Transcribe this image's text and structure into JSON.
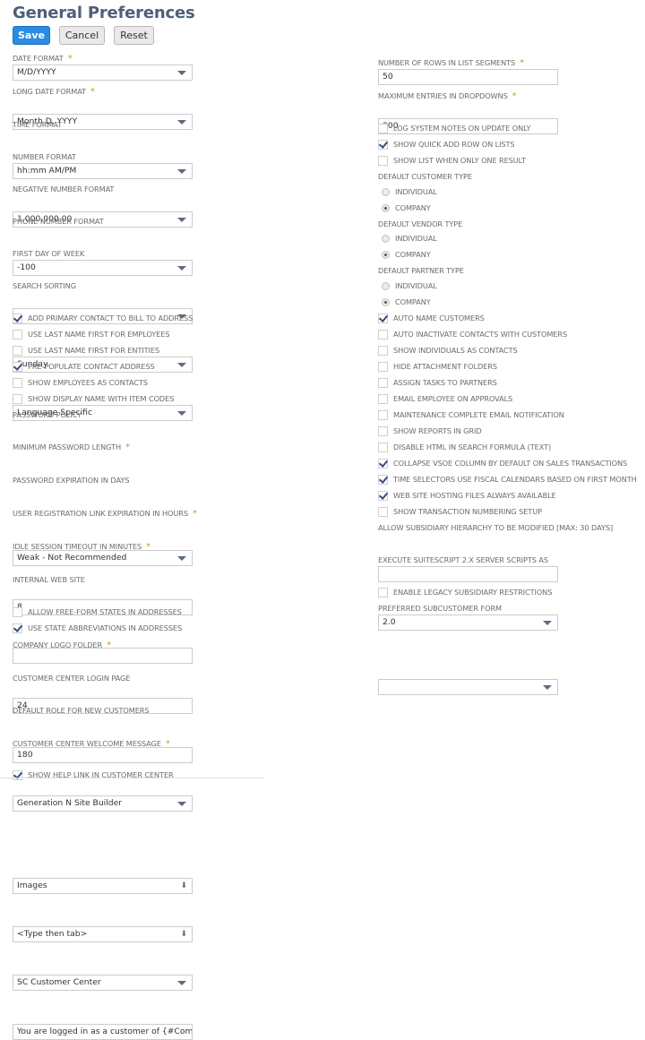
{
  "page": {
    "title": "General Preferences"
  },
  "toolbar": {
    "save": "Save",
    "cancel": "Cancel",
    "reset": "Reset"
  },
  "icons": {
    "dropdown": "caret-down-icon",
    "popup": "double-chevron-down-icon",
    "checkbox_checked": "checkmark-icon",
    "required": "asterisk"
  },
  "colors": {
    "primary_button": "#2b8be2",
    "title": "#4d5f79",
    "required_star": "#c89a2a",
    "checkmark": "#2e4f7e"
  },
  "left": {
    "date_format": {
      "label": "DATE FORMAT",
      "required": "*",
      "value": "M/D/YYYY"
    },
    "long_date_format": {
      "label": "LONG DATE FORMAT",
      "required": "*",
      "value": "Month D, YYYY"
    },
    "time_format": {
      "label": "TIME FORMAT",
      "value": "hh:mm AM/PM"
    },
    "number_format": {
      "label": "NUMBER FORMAT",
      "value": "1,000,000.00"
    },
    "negative_number_format": {
      "label": "NEGATIVE NUMBER FORMAT",
      "value": "-100"
    },
    "phone_number_format": {
      "label": "PHONE NUMBER FORMAT",
      "value": ""
    },
    "first_day_of_week": {
      "label": "FIRST DAY OF WEEK",
      "value": "Sunday"
    },
    "search_sorting": {
      "label": "SEARCH SORTING",
      "value": "Language Specific"
    },
    "checks1": [
      {
        "label": "ADD PRIMARY CONTACT TO BILL TO ADDRESS",
        "checked": true
      },
      {
        "label": "USE LAST NAME FIRST FOR EMPLOYEES",
        "checked": false
      },
      {
        "label": "USE LAST NAME FIRST FOR ENTITIES",
        "checked": false
      },
      {
        "label": "PRE-POPULATE CONTACT ADDRESS",
        "checked": true
      },
      {
        "label": "SHOW EMPLOYEES AS CONTACTS",
        "checked": false
      },
      {
        "label": "SHOW DISPLAY NAME WITH ITEM CODES",
        "checked": false
      }
    ],
    "password_policy": {
      "label": "PASSWORD POLICY",
      "value": "Weak - Not Recommended"
    },
    "min_password_length": {
      "label": "MINIMUM PASSWORD LENGTH",
      "required": "*",
      "value": "8"
    },
    "password_expiration": {
      "label": "PASSWORD EXPIRATION IN DAYS",
      "value": ""
    },
    "user_reg_link_expiration": {
      "label": "USER REGISTRATION LINK EXPIRATION IN HOURS",
      "required": "*",
      "value": "24"
    },
    "idle_session_timeout": {
      "label": "IDLE SESSION TIMEOUT IN MINUTES",
      "required": "*",
      "value": "180"
    },
    "internal_web_site": {
      "label": "INTERNAL WEB SITE",
      "value": "Generation N Site Builder"
    },
    "checks2": [
      {
        "label": "ALLOW FREE-FORM STATES IN ADDRESSES",
        "checked": false
      },
      {
        "label": "USE STATE ABBREVIATIONS IN ADDRESSES",
        "checked": true
      }
    ],
    "company_logo_folder": {
      "label": "COMPANY LOGO FOLDER",
      "required": "*",
      "value": "Images"
    },
    "customer_center_login_page": {
      "label": "CUSTOMER CENTER LOGIN PAGE",
      "value": "<Type then tab>"
    },
    "default_role_new_customers": {
      "label": "DEFAULT ROLE FOR NEW CUSTOMERS",
      "value": "SC Customer Center"
    },
    "customer_center_welcome": {
      "label": "CUSTOMER CENTER WELCOME MESSAGE",
      "required": "*",
      "value": "You are logged in as a customer of {#Company"
    },
    "show_help_link": {
      "label": "SHOW HELP LINK IN CUSTOMER CENTER",
      "checked": true
    }
  },
  "right": {
    "rows_in_list_segments": {
      "label": "NUMBER OF ROWS IN LIST SEGMENTS",
      "required": "*",
      "value": "50"
    },
    "max_entries_dropdowns": {
      "label": "MAXIMUM ENTRIES IN DROPDOWNS",
      "required": "*",
      "value": "200"
    },
    "checks1": [
      {
        "label": "LOG SYSTEM NOTES ON UPDATE ONLY",
        "checked": false
      },
      {
        "label": "SHOW QUICK ADD ROW ON LISTS",
        "checked": true
      },
      {
        "label": "SHOW LIST WHEN ONLY ONE RESULT",
        "checked": false
      }
    ],
    "default_customer_type": {
      "label": "DEFAULT CUSTOMER TYPE",
      "options": [
        "INDIVIDUAL",
        "COMPANY"
      ],
      "selected": "COMPANY"
    },
    "default_vendor_type": {
      "label": "DEFAULT VENDOR TYPE",
      "options": [
        "INDIVIDUAL",
        "COMPANY"
      ],
      "selected": "COMPANY"
    },
    "default_partner_type": {
      "label": "DEFAULT PARTNER TYPE",
      "options": [
        "INDIVIDUAL",
        "COMPANY"
      ],
      "selected": "COMPANY"
    },
    "checks2": [
      {
        "label": "AUTO NAME CUSTOMERS",
        "checked": true
      },
      {
        "label": "AUTO INACTIVATE CONTACTS WITH CUSTOMERS",
        "checked": false
      },
      {
        "label": "SHOW INDIVIDUALS AS CONTACTS",
        "checked": false
      },
      {
        "label": "HIDE ATTACHMENT FOLDERS",
        "checked": false
      },
      {
        "label": "ASSIGN TASKS TO PARTNERS",
        "checked": false
      },
      {
        "label": "EMAIL EMPLOYEE ON APPROVALS",
        "checked": false
      },
      {
        "label": "MAINTENANCE COMPLETE EMAIL NOTIFICATION",
        "checked": false
      },
      {
        "label": "SHOW REPORTS IN GRID",
        "checked": false
      },
      {
        "label": "DISABLE HTML IN SEARCH FORMULA (TEXT)",
        "checked": false
      },
      {
        "label": "COLLAPSE VSOE COLUMN BY DEFAULT ON SALES TRANSACTIONS",
        "checked": true
      },
      {
        "label": "TIME SELECTORS USE FISCAL CALENDARS BASED ON FIRST MONTH",
        "checked": true
      },
      {
        "label": "WEB SITE HOSTING FILES ALWAYS AVAILABLE",
        "checked": true
      },
      {
        "label": "SHOW TRANSACTION NUMBERING SETUP",
        "checked": false
      }
    ],
    "allow_subsidiary_hierarchy": {
      "label": "ALLOW SUBSIDIARY HIERARCHY TO BE MODIFIED [MAX: 30 DAYS]",
      "value": ""
    },
    "execute_suitescript": {
      "label": "EXECUTE SUITESCRIPT 2.X SERVER SCRIPTS AS",
      "value": "2.0"
    },
    "enable_legacy_subsidiary": {
      "label": "ENABLE LEGACY SUBSIDIARY RESTRICTIONS",
      "checked": false
    },
    "preferred_subcustomer_form": {
      "label": "PREFERRED SUBCUSTOMER FORM",
      "value": ""
    }
  }
}
